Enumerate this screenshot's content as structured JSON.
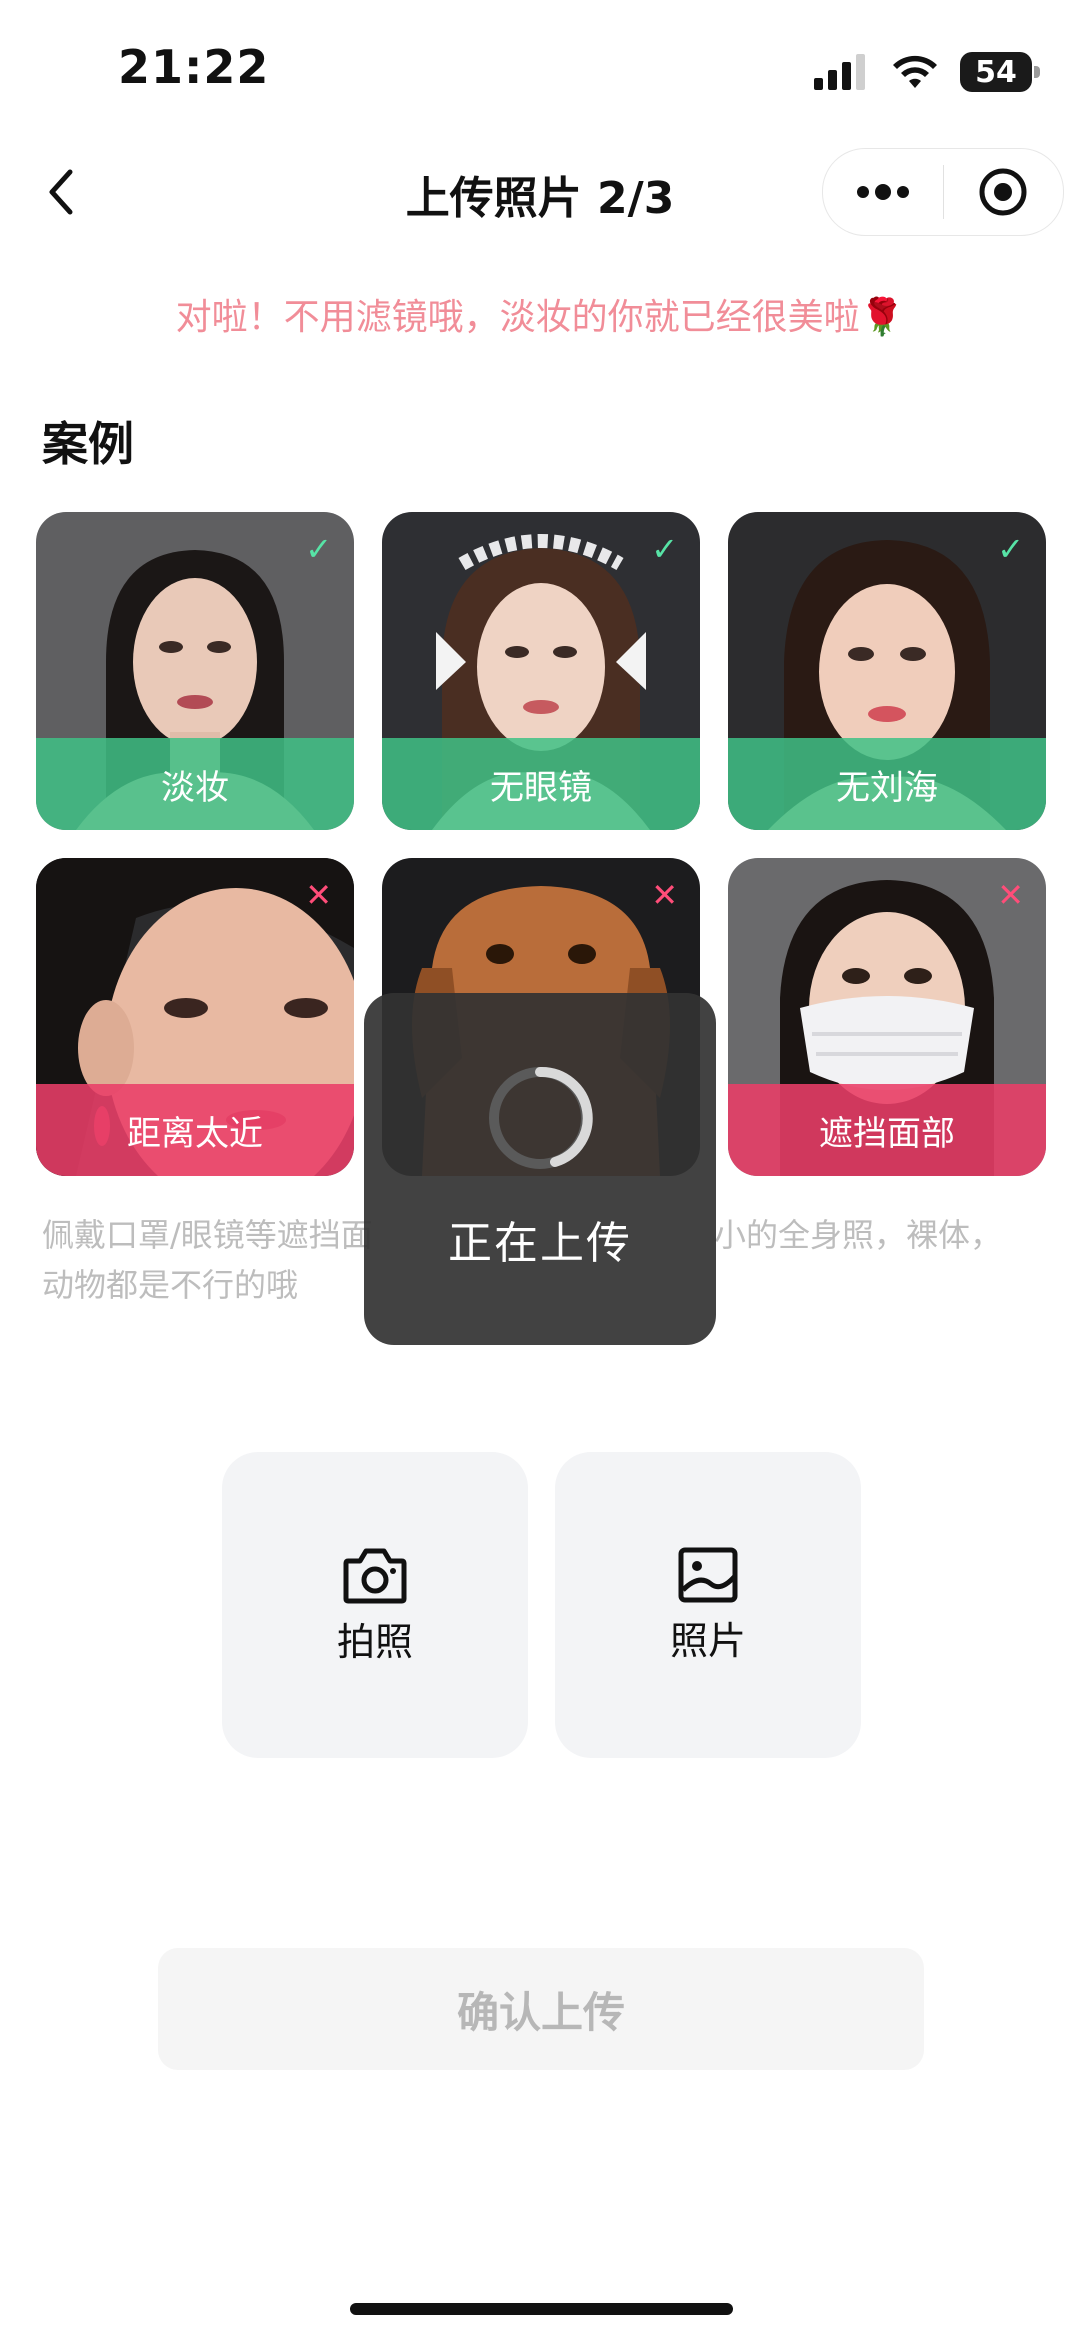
{
  "status": {
    "time": "21:22",
    "battery": "54"
  },
  "nav": {
    "title": "上传照片 2/3"
  },
  "tip": "对啦！不用滤镜哦，淡妆的你就已经很美啦🌹",
  "section": {
    "title": "案例"
  },
  "examples": [
    {
      "label": "淡妆",
      "status": "ok",
      "mark": "✓"
    },
    {
      "label": "无眼镜",
      "status": "ok",
      "mark": "✓"
    },
    {
      "label": "无刘海",
      "status": "ok",
      "mark": "✓"
    },
    {
      "label": "距离太近",
      "status": "bad",
      "mark": "✕"
    },
    {
      "label": "",
      "status": "bad",
      "mark": "✕"
    },
    {
      "label": "遮挡面部",
      "status": "bad",
      "mark": "✕"
    }
  ],
  "description": {
    "line1": "佩戴口罩/眼镜等遮挡面",
    "line1b": "小的全身照，裸体，",
    "line2": "动物都是不行的哦"
  },
  "actions": {
    "camera": "拍照",
    "album": "照片"
  },
  "confirm": "确认上传",
  "toast": {
    "text": "正在上传"
  },
  "colors": {
    "accent_ok": "#3fc186",
    "accent_bad": "#e93e68",
    "tip": "#f18d98"
  }
}
